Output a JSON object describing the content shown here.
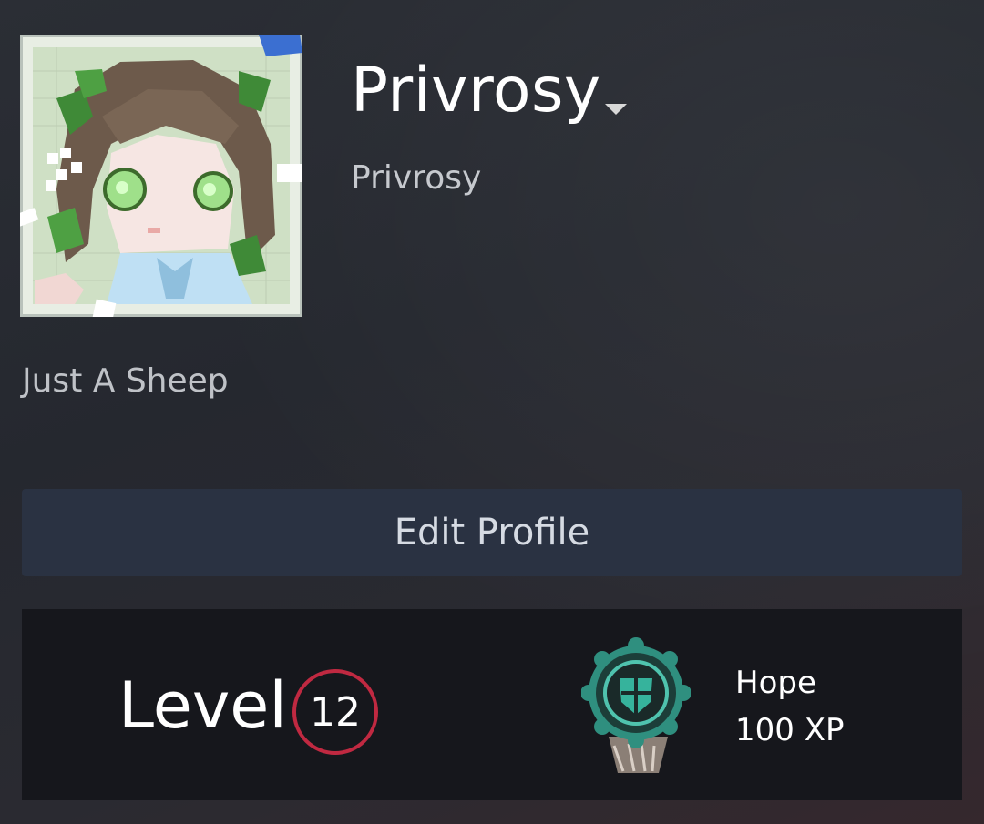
{
  "profile": {
    "persona_name": "Privrosy",
    "real_name": "Privrosy",
    "status": "Just A Sheep",
    "avatar_icon": "pixel-art-avatar-icon",
    "dropdown_icon": "caret-down-icon"
  },
  "actions": {
    "edit_profile_label": "Edit Profile"
  },
  "level": {
    "label": "Level",
    "value": "12",
    "ring_color": "#c02941"
  },
  "badge": {
    "name": "Hope",
    "xp": "100 XP",
    "icon": "hope-badge-icon",
    "accent": "#2fa896"
  }
}
